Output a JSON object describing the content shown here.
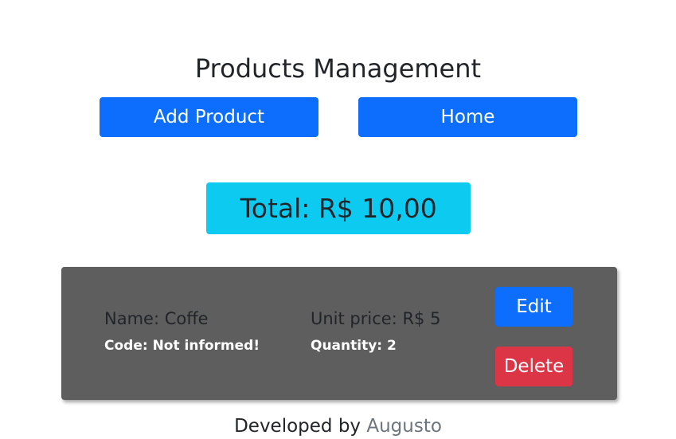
{
  "header": {
    "title": "Products Management"
  },
  "actions": {
    "add_product_label": "Add Product",
    "home_label": "Home"
  },
  "summary": {
    "total_text": "Total: R$ 10,00"
  },
  "products": [
    {
      "name_text": "Name: Coffe",
      "code_text": "Code: Not informed!",
      "unit_price_text": "Unit price: R$ 5",
      "quantity_text": "Quantity: 2",
      "edit_label": "Edit",
      "delete_label": "Delete"
    }
  ],
  "footer": {
    "prefix": "Developed by",
    "author": "Augusto"
  },
  "colors": {
    "primary": "#0d6efd",
    "info": "#0dcaf0",
    "danger": "#dc3545",
    "card_bg": "#5e5e5e",
    "muted": "#6c757d"
  }
}
